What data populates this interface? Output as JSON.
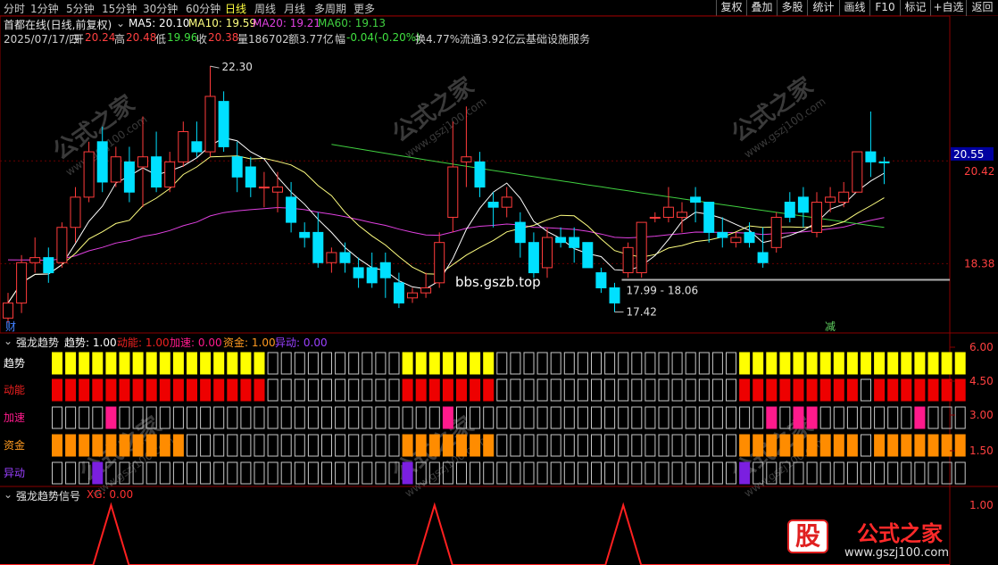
{
  "toolbar": {
    "periods": [
      "分时",
      "1分钟",
      "5分钟",
      "15分钟",
      "30分钟",
      "60分钟",
      "日线",
      "周线",
      "月线",
      "多周期",
      "更多"
    ],
    "period_x": [
      4,
      34,
      74,
      114,
      160,
      208,
      252,
      285,
      318,
      352,
      396
    ],
    "active_period": "日线",
    "buttons": [
      "复权",
      "叠加",
      "多股",
      "统计",
      "画线",
      "F10",
      "标记",
      "+自选",
      "返回"
    ],
    "button_x": [
      802,
      836,
      870,
      904,
      940,
      974,
      1008,
      1042,
      1082
    ],
    "button_w": [
      34,
      34,
      34,
      36,
      34,
      34,
      34,
      40,
      36
    ]
  },
  "header": {
    "title": "首都在线(日线,前复权)",
    "ma5": "MA5: 20.10",
    "ma10": "MA10: 19.59",
    "ma20": "MA20: 19.21",
    "ma60": "MA60: 19.13",
    "date": "2025/07/17/四",
    "open_label": "开",
    "open": "20.24",
    "high_label": "高",
    "high": "20.48",
    "low_label": "低",
    "low": "19.96",
    "close_label": "收",
    "close": "20.38",
    "vol": "量186702",
    "amount": "额3.77亿",
    "change_label": "幅",
    "change": "-0.04(-0.20%)",
    "turnover": "换4.77%",
    "float": "流通3.92亿",
    "concept": "云基础设施服务"
  },
  "colors": {
    "up": "#ff3b3b",
    "down": "#00e0ff",
    "ma5": "#ffffff",
    "ma10": "#ffff80",
    "ma20": "#e040e0",
    "ma60": "#40d040",
    "trend": "#ffff00",
    "kinetic": "#ee0000",
    "accel": "#ff1a8c",
    "capital": "#ff8c00",
    "unusual": "#7b1fe0"
  },
  "main_chart": {
    "price_axis": [
      "20.55",
      "20.42",
      "18.38"
    ],
    "high_label": "22.30",
    "low_label": "17.42",
    "range_label": "17.99 - 18.06",
    "watermark_site": "bbs.gszb.top",
    "tag_left": "财",
    "tag_right": "减"
  },
  "chart_data": {
    "type": "candlestick",
    "title": "首都在线(日线,前复权)",
    "ohlc": [
      [
        17.3,
        17.8,
        17.2,
        17.6
      ],
      [
        17.6,
        18.55,
        17.4,
        18.4
      ],
      [
        18.4,
        18.9,
        18.2,
        18.5
      ],
      [
        18.5,
        18.7,
        18.0,
        18.2
      ],
      [
        18.4,
        19.2,
        18.3,
        19.1
      ],
      [
        19.1,
        19.9,
        18.8,
        19.7
      ],
      [
        19.7,
        20.8,
        19.6,
        20.6
      ],
      [
        20.8,
        21.1,
        19.8,
        20.0
      ],
      [
        20.0,
        20.7,
        19.9,
        20.5
      ],
      [
        20.4,
        20.7,
        19.6,
        19.8
      ],
      [
        20.3,
        21.3,
        19.5,
        20.5
      ],
      [
        20.5,
        21.0,
        19.8,
        19.9
      ],
      [
        19.9,
        20.6,
        19.8,
        20.4
      ],
      [
        20.4,
        21.2,
        20.3,
        21.0
      ],
      [
        20.8,
        21.2,
        20.5,
        20.6
      ],
      [
        20.6,
        22.3,
        20.5,
        21.7
      ],
      [
        21.6,
        21.8,
        20.6,
        20.7
      ],
      [
        20.5,
        20.8,
        19.8,
        20.1
      ],
      [
        20.3,
        20.5,
        19.7,
        19.9
      ],
      [
        19.9,
        20.2,
        19.5,
        19.9
      ],
      [
        19.8,
        20.2,
        19.4,
        19.9
      ],
      [
        19.7,
        20.0,
        19.0,
        19.2
      ],
      [
        19.0,
        19.2,
        18.7,
        18.9
      ],
      [
        19.0,
        19.4,
        18.3,
        18.4
      ],
      [
        18.4,
        18.7,
        18.2,
        18.6
      ],
      [
        18.6,
        18.8,
        18.2,
        18.4
      ],
      [
        18.3,
        18.5,
        17.9,
        18.1
      ],
      [
        18.3,
        18.6,
        17.9,
        18.0
      ],
      [
        18.4,
        18.6,
        17.7,
        18.1
      ],
      [
        18.0,
        18.2,
        17.5,
        17.6
      ],
      [
        17.7,
        17.9,
        17.6,
        17.8
      ],
      [
        17.8,
        18.2,
        17.7,
        17.9
      ],
      [
        18.0,
        19.0,
        17.9,
        18.8
      ],
      [
        19.3,
        21.2,
        19.0,
        20.3
      ],
      [
        20.4,
        21.5,
        19.9,
        20.5
      ],
      [
        20.4,
        20.6,
        19.7,
        19.9
      ],
      [
        19.6,
        19.8,
        19.1,
        19.5
      ],
      [
        19.5,
        19.9,
        19.3,
        19.7
      ],
      [
        19.2,
        19.4,
        18.5,
        18.8
      ],
      [
        18.8,
        19.0,
        18.1,
        18.2
      ],
      [
        18.3,
        19.1,
        18.1,
        18.9
      ],
      [
        18.9,
        19.1,
        18.7,
        18.8
      ],
      [
        18.9,
        19.1,
        18.4,
        18.7
      ],
      [
        18.8,
        18.8,
        18.3,
        18.3
      ],
      [
        18.2,
        18.3,
        17.8,
        17.9
      ],
      [
        17.9,
        18.0,
        17.42,
        17.6
      ],
      [
        18.2,
        18.8,
        18.1,
        18.7
      ],
      [
        18.2,
        19.2,
        18.1,
        19.2
      ],
      [
        19.3,
        19.4,
        19.2,
        19.3
      ],
      [
        19.3,
        19.9,
        19.2,
        19.5
      ],
      [
        19.3,
        19.6,
        19.0,
        19.4
      ],
      [
        19.7,
        19.9,
        19.2,
        19.6
      ],
      [
        19.6,
        19.6,
        18.8,
        19.0
      ],
      [
        19.0,
        19.3,
        18.7,
        18.9
      ],
      [
        18.8,
        19.0,
        18.7,
        18.9
      ],
      [
        19.0,
        19.2,
        18.7,
        18.8
      ],
      [
        18.6,
        19.1,
        18.3,
        18.4
      ],
      [
        18.7,
        19.4,
        18.6,
        19.3
      ],
      [
        19.6,
        19.8,
        19.2,
        19.3
      ],
      [
        19.7,
        19.9,
        19.1,
        19.4
      ],
      [
        19.0,
        19.8,
        18.9,
        19.6
      ],
      [
        19.6,
        19.9,
        19.4,
        19.7
      ],
      [
        19.6,
        20.0,
        19.5,
        19.8
      ],
      [
        19.8,
        20.6,
        19.8,
        20.6
      ],
      [
        20.6,
        21.4,
        20.1,
        20.4
      ],
      [
        20.4,
        20.5,
        19.96,
        20.38
      ]
    ],
    "ylim": [
      17.2,
      22.55
    ],
    "indicator": {
      "name": "强龙趋势",
      "rows": [
        "趋势",
        "动能",
        "加速",
        "资金",
        "异动"
      ],
      "axis": [
        "6.00",
        "4.50",
        "3.00",
        "1.50"
      ],
      "legend": [
        {
          "label": "趋势:",
          "value": "1.00"
        },
        {
          "label": "动能:",
          "value": "1.00"
        },
        {
          "label": "加速:",
          "value": "0.00"
        },
        {
          "label": "资金:",
          "value": "1.00"
        },
        {
          "label": "异动:",
          "value": "0.00"
        }
      ],
      "trend": [
        1,
        1,
        1,
        1,
        1,
        1,
        1,
        1,
        1,
        1,
        1,
        1,
        1,
        1,
        1,
        1,
        0,
        0,
        0,
        0,
        0,
        0,
        0,
        0,
        0,
        0,
        1,
        1,
        1,
        1,
        1,
        1,
        1,
        0,
        0,
        0,
        0,
        0,
        0,
        0,
        0,
        0,
        0,
        0,
        0,
        0,
        0,
        0,
        0,
        0,
        0,
        1,
        1,
        1,
        1,
        1,
        1,
        1,
        1,
        1,
        1,
        1,
        1,
        1,
        1,
        1,
        1,
        1
      ],
      "kinetic": [
        1,
        1,
        1,
        1,
        1,
        1,
        1,
        1,
        1,
        1,
        1,
        1,
        1,
        1,
        1,
        1,
        0,
        0,
        0,
        0,
        0,
        0,
        0,
        0,
        0,
        0,
        1,
        1,
        1,
        1,
        1,
        1,
        1,
        0,
        0,
        0,
        0,
        0,
        0,
        0,
        0,
        0,
        0,
        0,
        0,
        0,
        0,
        0,
        0,
        0,
        0,
        1,
        1,
        1,
        1,
        1,
        1,
        1,
        1,
        1,
        0,
        1,
        1,
        1,
        1,
        1,
        1,
        1
      ],
      "accel": [
        0,
        0,
        0,
        0,
        1,
        0,
        0,
        0,
        0,
        0,
        0,
        0,
        0,
        0,
        0,
        0,
        0,
        0,
        0,
        0,
        0,
        0,
        0,
        0,
        0,
        0,
        0,
        0,
        0,
        1,
        0,
        0,
        0,
        0,
        0,
        0,
        0,
        0,
        0,
        0,
        0,
        0,
        0,
        0,
        0,
        0,
        0,
        0,
        0,
        0,
        0,
        0,
        0,
        1,
        0,
        1,
        1,
        0,
        0,
        0,
        0,
        0,
        0,
        0,
        1,
        0,
        0,
        0
      ],
      "capital": [
        1,
        1,
        1,
        1,
        1,
        1,
        1,
        1,
        1,
        1,
        0,
        0,
        0,
        0,
        0,
        0,
        0,
        0,
        0,
        0,
        0,
        0,
        0,
        0,
        0,
        0,
        1,
        1,
        1,
        1,
        1,
        1,
        1,
        0,
        0,
        0,
        0,
        0,
        0,
        0,
        0,
        0,
        0,
        0,
        0,
        0,
        0,
        0,
        0,
        0,
        0,
        1,
        1,
        1,
        1,
        1,
        1,
        1,
        1,
        1,
        0,
        1,
        1,
        1,
        1,
        1,
        1,
        1
      ],
      "unusual": [
        0,
        0,
        0,
        1,
        0,
        0,
        0,
        0,
        0,
        0,
        0,
        0,
        0,
        0,
        0,
        0,
        0,
        0,
        0,
        0,
        0,
        0,
        0,
        0,
        0,
        0,
        1,
        0,
        0,
        0,
        0,
        0,
        0,
        0,
        0,
        0,
        0,
        0,
        0,
        0,
        0,
        0,
        0,
        0,
        0,
        0,
        0,
        0,
        0,
        0,
        0,
        1,
        0,
        0,
        0,
        0,
        0,
        0,
        0,
        0,
        0,
        0,
        0,
        0,
        0,
        0,
        0,
        0
      ]
    },
    "signal": {
      "name": "强龙趋势信号",
      "label": "XG:",
      "value": "0.00",
      "axis": "1.00",
      "spikes": [
        4,
        28,
        42
      ]
    }
  },
  "watermark": {
    "text": "公式之家",
    "site": "www.gszj100.com",
    "badge": "股",
    "footer": "www.gszj100.com"
  }
}
